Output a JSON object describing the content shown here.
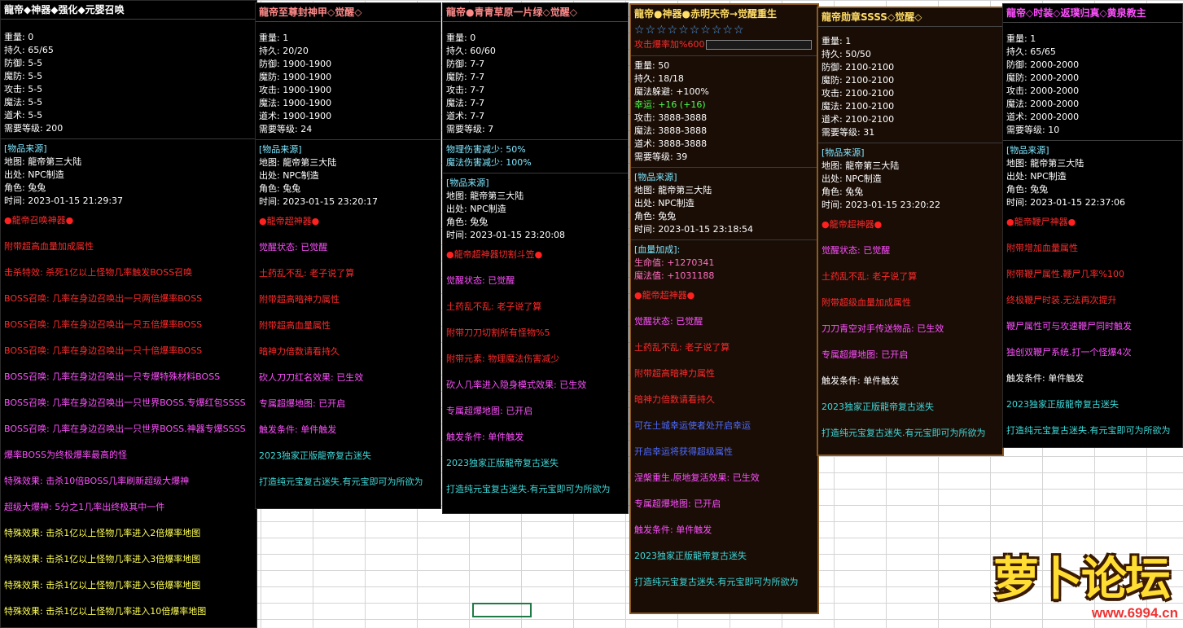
{
  "colors": {
    "title": "#ffdd66",
    "accent_orange": "#ff8a00",
    "red": "#ff2b2b",
    "magenta": "#ff50ff",
    "cyan": "#7fe7ff"
  },
  "panels": [
    {
      "title": "龍帝◆神器◆强化◆元婴召唤",
      "stats": [
        "重量: 0",
        "持久: 65/65",
        "防御: 5-5",
        "魔防: 5-5",
        "攻击: 5-5",
        "魔法: 5-5",
        "道术: 5-5",
        "需要等级: 200"
      ],
      "source_header": "[物品来源]",
      "source": [
        "地图: 龍帝第三大陆",
        "出处: NPC制造",
        "角色: 兔兔",
        "时间: 2023-01-15 21:29:37"
      ],
      "section": "龍帝召唤神器",
      "lines": [
        "附带超高血量加成属性",
        "击杀特效: 杀死1亿以上怪物几率触发BOSS召唤",
        "BOSS召唤: 几率在身边召唤出一只两倍爆率BOSS",
        "BOSS召唤: 几率在身边召唤出一只五倍爆率BOSS",
        "BOSS召唤: 几率在身边召唤出一只十倍爆率BOSS",
        "BOSS召唤: 几率在身边召唤出一只专爆特殊材料BOSS",
        "BOSS召唤: 几率在身边召唤出一只世界BOSS.专爆红包SSSS",
        "BOSS召唤: 几率在身边召唤出一只世界BOSS.神器专爆SSSS",
        "爆率BOSS为终极爆率最高的怪",
        "特殊效果: 击杀10倍BOSS几率刷新超级大爆神",
        "超级大爆神: 5分之1几率出终极其中一件",
        "特殊效果: 击杀1亿以上怪物几率进入2倍爆率地图",
        "特殊效果: 击杀1亿以上怪物几率进入3倍爆率地图",
        "特殊效果: 击杀1亿以上怪物几率进入5倍爆率地图",
        "特殊效果: 击杀1亿以上怪物几率进入10倍爆率地图"
      ]
    },
    {
      "title": "龍帝至尊封神甲◇觉醒◇",
      "stats": [
        "重量: 1",
        "持久: 20/20",
        "防御: 1900-1900",
        "魔防: 1900-1900",
        "攻击: 1900-1900",
        "魔法: 1900-1900",
        "道术: 1900-1900",
        "需要等级: 24"
      ],
      "source_header": "[物品来源]",
      "source": [
        "地图: 龍帝第三大陆",
        "出处: NPC制造",
        "角色: 兔兔",
        "时间: 2023-01-15 23:20:17"
      ],
      "section": "龍帝超神器",
      "lines": [
        "觉醒状态: 已觉醒",
        "土药乱不乱: 老子说了算",
        "附带超高暗神力属性",
        "附带超高血量属性",
        "暗神力倍数请看持久",
        "砍人刀刀红名效果: 已生效",
        "专属超爆地图: 已开启",
        "触发条件: 单件触发",
        "2023独家正版龍帝复古迷失",
        "打造纯元宝复古迷失.有元宝即可为所欲为"
      ]
    },
    {
      "title": "龍帝●青青草原一片绿◇觉醒◇",
      "stats": [
        "重量: 0",
        "持久: 60/60",
        "防御: 7-7",
        "魔防: 7-7",
        "攻击: 7-7",
        "魔法: 7-7",
        "道术: 7-7",
        "需要等级: 7"
      ],
      "extra": [
        "物理伤害减少: 50%",
        "魔法伤害减少: 100%"
      ],
      "source_header": "[物品来源]",
      "source": [
        "地图: 龍帝第三大陆",
        "出处: NPC制造",
        "角色: 兔兔",
        "时间: 2023-01-15 23:20:08"
      ],
      "section": "龍帝超神器切割斗笠",
      "lines": [
        "觉醒状态: 已觉醒",
        "土药乱不乱: 老子说了算",
        "附带刀刀切割所有怪物%5",
        "附带元素: 物理魔法伤害减少",
        "砍人几率进入隐身模式效果: 已生效",
        "专属超爆地图: 已开启",
        "触发条件: 单件触发",
        "2023独家正版龍帝复古迷失",
        "打造纯元宝复古迷失.有元宝即可为所欲为"
      ]
    },
    {
      "title": "龍帝●神器●赤明天帝→觉醒重生",
      "stars": "☆☆☆☆☆☆☆☆☆☆",
      "bar_label": "攻击爆率加%600",
      "bar_fill": 0.0,
      "stats": [
        "重量: 50",
        "持久: 18/18",
        "魔法躲避: +100%"
      ],
      "luck": "幸运: +16 (+16)",
      "stats2": [
        "攻击: 3888-3888",
        "魔法: 3888-3888",
        "道术: 3888-3888",
        "需要等级: 39"
      ],
      "source_header": "[物品来源]",
      "source": [
        "地图: 龍帝第三大陆",
        "出处: NPC制造",
        "角色: 兔兔",
        "时间: 2023-01-15 23:18:54"
      ],
      "blood_header": "[血量加成]:",
      "blood": [
        "生命值: +1270341",
        "魔法值: +1031188"
      ],
      "section": "龍帝超神器",
      "lines": [
        "觉醒状态: 已觉醒",
        "土药乱不乱: 老子说了算",
        "附带超高暗神力属性",
        "暗神力倍数请看持久",
        "可在土城幸运使者处开启幸运",
        "开启幸运将获得超级属性",
        "涅槃重生.原地复活效果: 已生效",
        "专属超爆地图: 已开启",
        "触发条件: 单件触发",
        "2023独家正版龍帝复古迷失",
        "打造纯元宝复古迷失.有元宝即可为所欲为"
      ]
    },
    {
      "title": "龍帝勋章SSSS◇觉醒◇",
      "stats": [
        "重量: 1",
        "持久: 50/50",
        "防御: 2100-2100",
        "魔防: 2100-2100",
        "攻击: 2100-2100",
        "魔法: 2100-2100",
        "道术: 2100-2100",
        "需要等级: 31"
      ],
      "source_header": "[物品来源]",
      "source": [
        "地图: 龍帝第三大陆",
        "出处: NPC制造",
        "角色: 兔兔",
        "时间: 2023-01-15 23:20:22"
      ],
      "section": "龍帝超神器",
      "lines": [
        "觉醒状态: 已觉醒",
        "土药乱不乱: 老子说了算",
        "附带超级血量加成属性",
        "刀刀青空对手传送物品: 已生效",
        "专属超爆地图: 已开启",
        "触发条件: 单件触发",
        "2023独家正版龍帝复古迷失",
        "打造纯元宝复古迷失.有元宝即可为所欲为"
      ]
    },
    {
      "title": "龍帝◇时装◇返璞归真◇黄泉教主",
      "stats": [
        "重量: 1",
        "持久: 65/65",
        "防御: 2000-2000",
        "魔防: 2000-2000",
        "攻击: 2000-2000",
        "魔法: 2000-2000",
        "道术: 2000-2000",
        "需要等级: 10"
      ],
      "source_header": "[物品来源]",
      "source": [
        "地图: 龍帝第三大陆",
        "出处: NPC制造",
        "角色: 兔兔",
        "时间: 2023-01-15 22:37:06"
      ],
      "section": "龍帝鞭尸神器",
      "lines": [
        "附带增加血量属性",
        "附带鞭尸属性.鞭尸几率%100",
        "终极鞭尸时装.无法再次提升",
        "鞭尸属性可与攻速鞭尸同时触发",
        "独创双鞭尸系统.打一个怪爆4次",
        "触发条件: 单件触发",
        "2023独家正版龍帝复古迷失",
        "打造纯元宝复古迷失.有元宝即可为所欲为"
      ]
    }
  ],
  "logo": {
    "text": "萝卜论坛",
    "url": "www.6994.cn"
  }
}
